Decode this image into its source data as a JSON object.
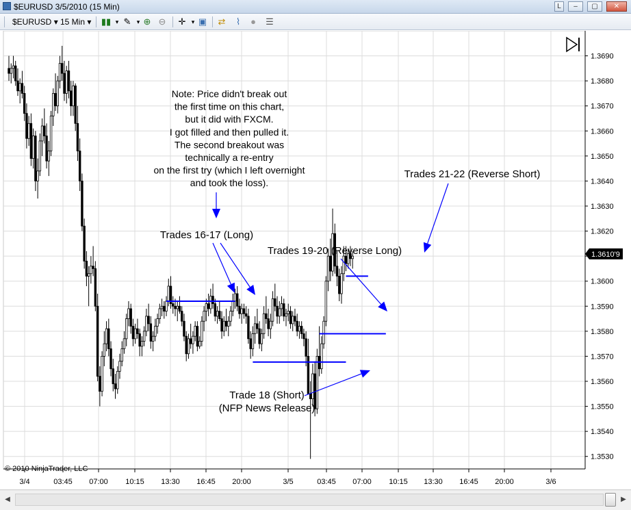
{
  "window": {
    "title": "$EURUSD  3/5/2010 (15 Min)",
    "buttons": [
      "L",
      "–",
      "▢",
      "✕"
    ]
  },
  "toolbar": {
    "instrument": "$EURUSD",
    "interval": "15 Min"
  },
  "chart_data": {
    "type": "candlestick",
    "instrument": "$EURUSD",
    "interval": "15 Min",
    "ylim": [
      1.3525,
      1.37
    ],
    "y_ticks": [
      "1.3690",
      "1.3680",
      "1.3670",
      "1.3660",
      "1.3650",
      "1.3640",
      "1.3630",
      "1.3620",
      "1.3610",
      "1.3600",
      "1.3590",
      "1.3580",
      "1.3570",
      "1.3560",
      "1.3550",
      "1.3540",
      "1.3530"
    ],
    "x_ticks": [
      "3/4",
      "03:45",
      "07:00",
      "10:15",
      "13:30",
      "16:45",
      "20:00",
      "3/5",
      "03:45",
      "07:00",
      "10:15",
      "13:30",
      "16:45",
      "20:00",
      "3/6"
    ],
    "last_price_label": "1.3610'9",
    "last_price": 1.36109,
    "copyright": "© 2010 NinjaTrader, LLC",
    "levels": [
      {
        "price": 1.3592,
        "from_bar": 71,
        "to_bar": 102
      },
      {
        "price": 1.35677,
        "from_bar": 110,
        "to_bar": 152
      },
      {
        "price": 1.3579,
        "from_bar": 140,
        "to_bar": 170
      },
      {
        "price": 1.3602,
        "from_bar": 152,
        "to_bar": 162
      }
    ],
    "annotations": [
      {
        "lines": [
          "Note: Price didn't break out",
          "the first time on this chart,",
          "but it did with FXCM.",
          "I got filled and then pulled it.",
          "The second breakout was",
          "technically a re-entry",
          "on the first try (which I left overnight",
          "and took the loss)."
        ]
      },
      {
        "lines": [
          "Trades 16-17 (Long)"
        ]
      },
      {
        "lines": [
          "Trades 19-20 (Reverse Long)"
        ]
      },
      {
        "lines": [
          "Trades 21-22 (Reverse Short)"
        ]
      },
      {
        "lines": [
          "Trade 18 (Short)",
          "(NFP News Release)"
        ]
      }
    ],
    "candles": [
      [
        1.3685,
        1.369,
        1.368,
        1.3683
      ],
      [
        1.3683,
        1.3687,
        1.3679,
        1.3685
      ],
      [
        1.3685,
        1.369,
        1.3681,
        1.3686
      ],
      [
        1.3686,
        1.3688,
        1.3678,
        1.368
      ],
      [
        1.368,
        1.3685,
        1.3674,
        1.3676
      ],
      [
        1.3676,
        1.3681,
        1.3671,
        1.3679
      ],
      [
        1.3679,
        1.3684,
        1.3673,
        1.3675
      ],
      [
        1.3675,
        1.3678,
        1.3664,
        1.3667
      ],
      [
        1.3667,
        1.3671,
        1.3653,
        1.3657
      ],
      [
        1.3657,
        1.3666,
        1.3654,
        1.3663
      ],
      [
        1.3663,
        1.3667,
        1.3646,
        1.3649
      ],
      [
        1.3649,
        1.3661,
        1.3645,
        1.3658
      ],
      [
        1.3658,
        1.366,
        1.3636,
        1.364
      ],
      [
        1.364,
        1.3649,
        1.3633,
        1.3644
      ],
      [
        1.3644,
        1.3659,
        1.3642,
        1.3656
      ],
      [
        1.3656,
        1.3665,
        1.365,
        1.3662
      ],
      [
        1.3662,
        1.3669,
        1.3655,
        1.3658
      ],
      [
        1.3658,
        1.3663,
        1.3645,
        1.3648
      ],
      [
        1.3648,
        1.3656,
        1.3642,
        1.3652
      ],
      [
        1.3652,
        1.3668,
        1.365,
        1.3666
      ],
      [
        1.3666,
        1.3677,
        1.3662,
        1.3675
      ],
      [
        1.3675,
        1.3683,
        1.3668,
        1.367
      ],
      [
        1.367,
        1.3682,
        1.3667,
        1.368
      ],
      [
        1.368,
        1.369,
        1.3677,
        1.3687
      ],
      [
        1.3687,
        1.3694,
        1.368,
        1.3683
      ],
      [
        1.3683,
        1.3688,
        1.3672,
        1.3675
      ],
      [
        1.3675,
        1.3686,
        1.3671,
        1.3684
      ],
      [
        1.3684,
        1.3688,
        1.3673,
        1.3676
      ],
      [
        1.3676,
        1.368,
        1.3666,
        1.367
      ],
      [
        1.367,
        1.368,
        1.3666,
        1.3678
      ],
      [
        1.3678,
        1.3679,
        1.366,
        1.3663
      ],
      [
        1.3663,
        1.367,
        1.3648,
        1.3652
      ],
      [
        1.3652,
        1.3657,
        1.3636,
        1.364
      ],
      [
        1.364,
        1.3643,
        1.362,
        1.3622
      ],
      [
        1.3622,
        1.3625,
        1.3605,
        1.3608
      ],
      [
        1.3608,
        1.3612,
        1.3598,
        1.3602
      ],
      [
        1.3602,
        1.3606,
        1.359,
        1.3603
      ],
      [
        1.3603,
        1.361,
        1.3599,
        1.3606
      ],
      [
        1.3606,
        1.3614,
        1.3602,
        1.3605
      ],
      [
        1.3605,
        1.3608,
        1.3588,
        1.359
      ],
      [
        1.359,
        1.3595,
        1.356,
        1.3562
      ],
      [
        1.3562,
        1.3566,
        1.355,
        1.3556
      ],
      [
        1.3556,
        1.3572,
        1.3554,
        1.357
      ],
      [
        1.357,
        1.358,
        1.3566,
        1.3575
      ],
      [
        1.3575,
        1.3584,
        1.3572,
        1.3581
      ],
      [
        1.3581,
        1.3585,
        1.357,
        1.3573
      ],
      [
        1.3573,
        1.3576,
        1.3562,
        1.3565
      ],
      [
        1.3565,
        1.3569,
        1.3556,
        1.3559
      ],
      [
        1.3559,
        1.3563,
        1.3553,
        1.3557
      ],
      [
        1.3557,
        1.3566,
        1.3555,
        1.3564
      ],
      [
        1.3564,
        1.3571,
        1.3561,
        1.3568
      ],
      [
        1.3568,
        1.3576,
        1.3566,
        1.3573
      ],
      [
        1.3573,
        1.358,
        1.3571,
        1.3577
      ],
      [
        1.3577,
        1.3587,
        1.3574,
        1.3585
      ],
      [
        1.3585,
        1.3592,
        1.3582,
        1.3589
      ],
      [
        1.3589,
        1.3591,
        1.3579,
        1.3582
      ],
      [
        1.3582,
        1.3585,
        1.3574,
        1.3577
      ],
      [
        1.3577,
        1.3583,
        1.3575,
        1.3581
      ],
      [
        1.3581,
        1.3585,
        1.3577,
        1.3579
      ],
      [
        1.3579,
        1.3581,
        1.357,
        1.3574
      ],
      [
        1.3574,
        1.3578,
        1.357,
        1.3576
      ],
      [
        1.3576,
        1.3582,
        1.3574,
        1.358
      ],
      [
        1.358,
        1.3589,
        1.3578,
        1.3586
      ],
      [
        1.3586,
        1.3591,
        1.358,
        1.3583
      ],
      [
        1.3583,
        1.3586,
        1.3573,
        1.3576
      ],
      [
        1.3576,
        1.358,
        1.3572,
        1.3578
      ],
      [
        1.3578,
        1.3585,
        1.3576,
        1.3582
      ],
      [
        1.3582,
        1.3587,
        1.3579,
        1.3585
      ],
      [
        1.3585,
        1.3591,
        1.3583,
        1.3589
      ],
      [
        1.3589,
        1.3593,
        1.3586,
        1.359
      ],
      [
        1.359,
        1.3592,
        1.3585,
        1.3588
      ],
      [
        1.3588,
        1.3594,
        1.3586,
        1.3592
      ],
      [
        1.3592,
        1.3601,
        1.359,
        1.3598
      ],
      [
        1.3598,
        1.3602,
        1.3589,
        1.3591
      ],
      [
        1.3591,
        1.3594,
        1.3587,
        1.359
      ],
      [
        1.359,
        1.3593,
        1.3586,
        1.3589
      ],
      [
        1.3589,
        1.3592,
        1.3584,
        1.359
      ],
      [
        1.359,
        1.3594,
        1.3587,
        1.3588
      ],
      [
        1.3588,
        1.359,
        1.3582,
        1.3584
      ],
      [
        1.3584,
        1.3587,
        1.3576,
        1.3578
      ],
      [
        1.3578,
        1.358,
        1.3568,
        1.3571
      ],
      [
        1.3571,
        1.3579,
        1.3569,
        1.3577
      ],
      [
        1.3577,
        1.3583,
        1.3573,
        1.3575
      ],
      [
        1.3575,
        1.358,
        1.3571,
        1.3578
      ],
      [
        1.3578,
        1.3584,
        1.3576,
        1.3582
      ],
      [
        1.3582,
        1.3584,
        1.3572,
        1.3574
      ],
      [
        1.3574,
        1.3578,
        1.3573,
        1.3576
      ],
      [
        1.3576,
        1.3586,
        1.3574,
        1.3584
      ],
      [
        1.3584,
        1.359,
        1.358,
        1.3588
      ],
      [
        1.3588,
        1.3593,
        1.3584,
        1.3591
      ],
      [
        1.3591,
        1.3595,
        1.3586,
        1.3589
      ],
      [
        1.3589,
        1.3597,
        1.3587,
        1.3594
      ],
      [
        1.3594,
        1.3599,
        1.3589,
        1.3591
      ],
      [
        1.3591,
        1.3593,
        1.3584,
        1.3586
      ],
      [
        1.3586,
        1.359,
        1.3583,
        1.3588
      ],
      [
        1.3588,
        1.3592,
        1.3584,
        1.3585
      ],
      [
        1.3585,
        1.3588,
        1.3577,
        1.358
      ],
      [
        1.358,
        1.3586,
        1.3578,
        1.3584
      ],
      [
        1.3584,
        1.3589,
        1.358,
        1.3582
      ],
      [
        1.3582,
        1.3586,
        1.3578,
        1.3584
      ],
      [
        1.3584,
        1.359,
        1.3582,
        1.3588
      ],
      [
        1.3588,
        1.3595,
        1.3586,
        1.3592
      ],
      [
        1.3592,
        1.3597,
        1.3589,
        1.3595
      ],
      [
        1.3595,
        1.3598,
        1.3588,
        1.359
      ],
      [
        1.359,
        1.3593,
        1.3585,
        1.3587
      ],
      [
        1.3587,
        1.3591,
        1.3583,
        1.3589
      ],
      [
        1.3589,
        1.3591,
        1.3585,
        1.3587
      ],
      [
        1.3587,
        1.359,
        1.3583,
        1.3586
      ],
      [
        1.3586,
        1.3589,
        1.3575,
        1.3577
      ],
      [
        1.3577,
        1.358,
        1.3569,
        1.3573
      ],
      [
        1.3573,
        1.3582,
        1.357,
        1.3579
      ],
      [
        1.3579,
        1.3586,
        1.3575,
        1.3583
      ],
      [
        1.3583,
        1.3589,
        1.3579,
        1.3581
      ],
      [
        1.3581,
        1.3584,
        1.3573,
        1.3575
      ],
      [
        1.3575,
        1.3581,
        1.3572,
        1.3579
      ],
      [
        1.3579,
        1.359,
        1.3577,
        1.3587
      ],
      [
        1.3587,
        1.3594,
        1.3583,
        1.3585
      ],
      [
        1.3585,
        1.3589,
        1.3578,
        1.3581
      ],
      [
        1.3581,
        1.3587,
        1.3577,
        1.3584
      ],
      [
        1.3584,
        1.3596,
        1.3582,
        1.3593
      ],
      [
        1.3593,
        1.3599,
        1.3588,
        1.359
      ],
      [
        1.359,
        1.3594,
        1.3583,
        1.3586
      ],
      [
        1.3586,
        1.3592,
        1.3583,
        1.3589
      ],
      [
        1.3589,
        1.3594,
        1.3586,
        1.3591
      ],
      [
        1.3591,
        1.3593,
        1.3584,
        1.3586
      ],
      [
        1.3586,
        1.3589,
        1.3582,
        1.3587
      ],
      [
        1.3587,
        1.3591,
        1.3584,
        1.3588
      ],
      [
        1.3588,
        1.359,
        1.3581,
        1.3583
      ],
      [
        1.3583,
        1.3588,
        1.358,
        1.3586
      ],
      [
        1.3586,
        1.3589,
        1.3582,
        1.3584
      ],
      [
        1.3584,
        1.3587,
        1.3578,
        1.358
      ],
      [
        1.358,
        1.3584,
        1.3577,
        1.3582
      ],
      [
        1.3582,
        1.3584,
        1.3577,
        1.3579
      ],
      [
        1.3579,
        1.3581,
        1.3574,
        1.3577
      ],
      [
        1.3577,
        1.358,
        1.3566,
        1.357
      ],
      [
        1.357,
        1.3577,
        1.356,
        1.3555
      ],
      [
        1.3555,
        1.356,
        1.3529,
        1.3553
      ],
      [
        1.3553,
        1.3567,
        1.355,
        1.3563
      ],
      [
        1.3563,
        1.3568,
        1.3546,
        1.3549
      ],
      [
        1.3549,
        1.3573,
        1.3547,
        1.357
      ],
      [
        1.357,
        1.3582,
        1.3562,
        1.3565
      ],
      [
        1.3565,
        1.3578,
        1.3563,
        1.3575
      ],
      [
        1.3575,
        1.3586,
        1.3573,
        1.3584
      ],
      [
        1.3584,
        1.3602,
        1.3582,
        1.36
      ],
      [
        1.36,
        1.3613,
        1.3596,
        1.361
      ],
      [
        1.361,
        1.3617,
        1.36,
        1.3604
      ],
      [
        1.3604,
        1.3629,
        1.3602,
        1.3619
      ],
      [
        1.3619,
        1.3623,
        1.3603,
        1.3606
      ],
      [
        1.3606,
        1.3612,
        1.3598,
        1.3602
      ],
      [
        1.3602,
        1.3605,
        1.3592,
        1.3595
      ],
      [
        1.3595,
        1.3606,
        1.3591,
        1.3603
      ],
      [
        1.3603,
        1.3614,
        1.36,
        1.361
      ],
      [
        1.361,
        1.3614,
        1.3604,
        1.3607
      ],
      [
        1.3607,
        1.3613,
        1.3605,
        1.3611
      ],
      [
        1.3611,
        1.3614,
        1.3606,
        1.3609
      ],
      [
        1.3609,
        1.3612,
        1.3605,
        1.361
      ]
    ]
  }
}
